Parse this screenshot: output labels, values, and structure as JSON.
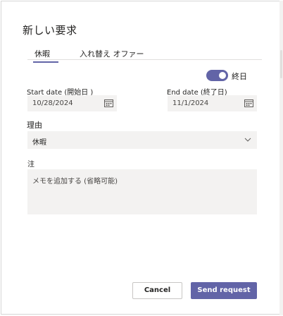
{
  "dialog": {
    "title": "新しい要求"
  },
  "tabs": [
    {
      "label": "休暇",
      "active": true
    },
    {
      "label": "入れ替え  オファー",
      "active": false
    }
  ],
  "all_day": {
    "label": "終日",
    "on": true
  },
  "start_date": {
    "label": "Start date (開始日 )",
    "value": "10/28/2024"
  },
  "end_date": {
    "label": "End date (終了日)",
    "value": "11/1/2024"
  },
  "reason": {
    "label": "理由",
    "value": "休暇"
  },
  "note": {
    "label": "注",
    "placeholder": "メモを追加する (省略可能)"
  },
  "buttons": {
    "cancel": "Cancel",
    "send": "Send request"
  },
  "colors": {
    "accent": "#6264a7",
    "input_bg": "#f3f2f1"
  }
}
